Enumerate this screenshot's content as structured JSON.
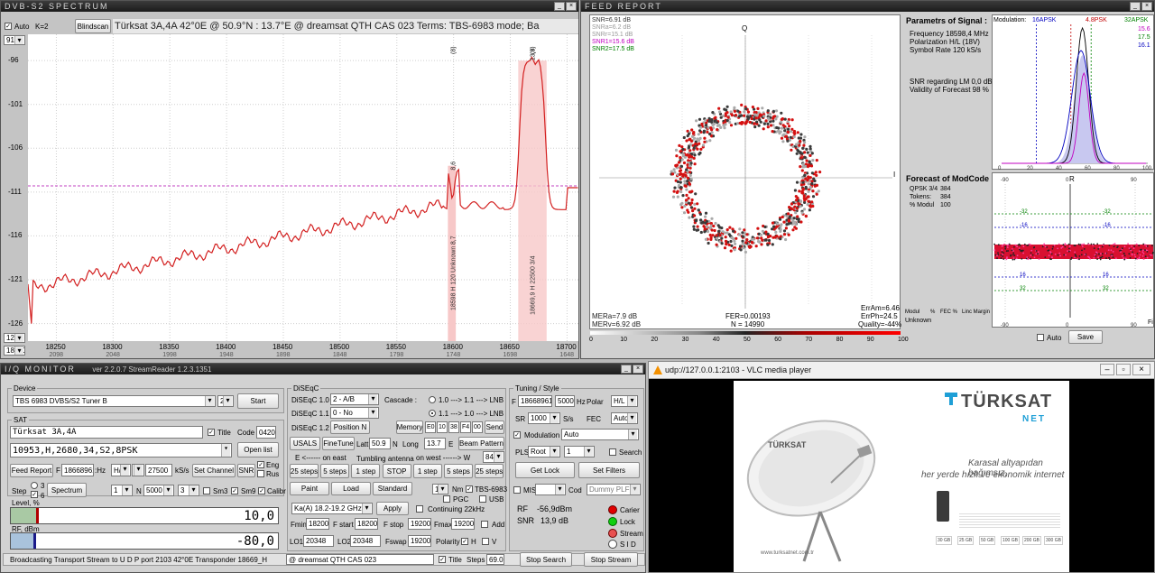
{
  "spectrum": {
    "title": "DVB-S2  SPECTRUM",
    "auto_label": "Auto",
    "k_label": "K=2",
    "blindscan_label": "Blindscan",
    "header_text": "Türksat 3A,4A    42°0E  @  50.9°N : 13.7°E     @ dreamsat QTH CAS 023      Terms:  TBS-6983 mode; Ba",
    "top_value": "91",
    "bottom_value": "12",
    "freq_box": "18200",
    "y_ticks": [
      "-96",
      "-101",
      "-106",
      "-111",
      "-116",
      "-121",
      "-126"
    ],
    "x_ticks": [
      "18250",
      "18300",
      "18350",
      "18400",
      "18450",
      "18500",
      "18550",
      "18600",
      "18650",
      "18700"
    ],
    "x_sub_ticks": [
      "2098",
      "2048",
      "1998",
      "1948",
      "1898",
      "1848",
      "1798",
      "1748",
      "1698",
      "1648"
    ],
    "marker1_top": "(8)",
    "marker2_top": "(9)",
    "peak1_value": "8,6",
    "peak1_snr": "8,7",
    "peak1_label": "18598 H  120  Unknown",
    "peak2_value": "13,8",
    "peak2_label": "18669,9 H  22500 3/4",
    "line_color": "#d32020"
  },
  "feed": {
    "title": "FEED  REPORT",
    "snr_lines": [
      "SNR=6.91 dB",
      "SNRa=6.2 dB",
      "SNRr=15.1 dB",
      "SNR1=15.6 dB",
      "SNR2=17.5 dB"
    ],
    "q_label": "Q",
    "i_label": "I",
    "mera": "MERa=7.9 dB",
    "merv": "MERv=6.92 dB",
    "fer": "FER=0.00193",
    "n_val": "N = 14990",
    "erram": "ErrAm=6.46",
    "errph": "ErrPh=24.5",
    "quality": "Quality=-44%",
    "scale": [
      "0",
      "10",
      "20",
      "30",
      "40",
      "50",
      "60",
      "70",
      "80",
      "90",
      "100"
    ],
    "params_title": "Parametrs of Signal :",
    "frequency": "Frequency   18598,4 MHz",
    "polarization": "Polarization   H/L (18V)",
    "symbol_rate": "Symbol Rate   120 kS/s",
    "snr_lm": "SNR regarding LM  0,0 dB",
    "validity": "Validity of Forecast  98 %",
    "forecast_title": "Forecast of ModCode",
    "fc_rows": [
      [
        "QPSK 3/4",
        "384"
      ],
      [
        "Tokens:",
        "384"
      ],
      [
        "% Modul",
        "100"
      ]
    ],
    "mod_header": [
      "Modul",
      "%",
      "FEC %",
      "Linc Margin"
    ],
    "mod_unknown": "Unknown",
    "modulation_label": "Modulation:",
    "mod_16apsk": "16APSK",
    "mod_48psk": "4.8PSK",
    "mod_32apsk": "32APSK",
    "right_vals": [
      "15.6",
      "17.5",
      "16.1"
    ],
    "hist_x": [
      "0",
      "20",
      "40",
      "60",
      "80",
      "100"
    ],
    "r_label": "R",
    "pol_x": [
      "-90",
      "0",
      "90"
    ],
    "pol_side": [
      "-32",
      "-16",
      "16",
      "32"
    ],
    "fi_label": "Fi",
    "auto_label": "Auto",
    "save_label": "Save"
  },
  "iq": {
    "title": "I/Q  MONITOR",
    "version": "ver 2.2.0.7  StreamReader 1.2.3.1351",
    "device_label": "Device",
    "device_value": "TBS 6983 DVBS/S2 Tuner B",
    "device_num": "2",
    "start_label": "Start",
    "sat_label": "SAT",
    "sat_value": "Türksat 3A,4A",
    "title_chk": "Title",
    "code_label": "Code",
    "code_value": "0420",
    "tp_value": "10953,H,2680,34,S2,8PSK",
    "open_list": "Open list",
    "feed_report": "Feed Report",
    "f_label": "F",
    "f_value": "18668961",
    "hz_label": ":Hz",
    "pol_value": "H/L",
    "pol_num": "1",
    "sr_value": "27500",
    "ks_label": "kS/s",
    "set_channel": "Set Channel",
    "snr_btn": "SNR",
    "eng_label": "Eng",
    "rus_label": "Rus",
    "step_label": "Step",
    "step3": "3",
    "step6": "6",
    "spectrum_btn": "Spectrum",
    "n1": "1",
    "n_label": "N",
    "n_value": "5000",
    "n3": "3",
    "sm3": "Sm3",
    "sm9": "Sm9",
    "calibr": "Calibr",
    "level_label": "Level, %",
    "level_value": "10,0",
    "rf_label": "RF, dBm",
    "rf_value": "-80,0",
    "status_text": "Broadcasting Transport Stream to  U D P port 2103    42°0E  Transponder  18669_H",
    "level_fill": 0.1,
    "rf_fill": 0.09
  },
  "diseqc": {
    "label": "DiSEqC",
    "d10": "DiSEqC 1.0",
    "d10v": "2 - A/B",
    "d11": "DiSEqC 1.1",
    "d11v": "0 - No",
    "d12": "DiSEqC 1.2",
    "position": "Position",
    "pos_n": "N",
    "cascade": "Cascade :",
    "casc1": "1.0 ---> 1.1 ---> LNB",
    "casc2": "1.1 ---> 1.0 ---> LNB",
    "memory": "Memory",
    "mem_vals": [
      "E0",
      "10",
      "38",
      "F4",
      "00"
    ],
    "send": "Send",
    "usals": "USALS",
    "finetune": "FineTune",
    "latt": "Latt",
    "latt_v": "50.9",
    "n_lbl": "N",
    "long": "Long",
    "long_v": "13.7",
    "e_lbl": "E",
    "beam": "Beam Pattern",
    "east": "E <------ on east",
    "tumbling": "Tumbling antenna",
    "west": "on  west  ------> W",
    "w_val": "84",
    "steps": [
      "25 steps",
      "5 steps",
      "1 step",
      "STOP",
      "1 step",
      "5 steps",
      "25 steps"
    ],
    "paint": "Paint",
    "load": "Load",
    "standard": "Standard",
    "nm_val": "1",
    "nm": "Nm",
    "tbs": "TBS-6983",
    "pgc": "PGC",
    "usb": "USB",
    "band": "Ka(A) 18.2-19.2 GHz",
    "apply": "Apply",
    "cont22": "Continuing 22kHz",
    "fmin": "Fmin",
    "fmin_v": "18200",
    "fstart": "F start",
    "fstart_v": "18200",
    "fstop": "F stop",
    "fstop_v": "19200",
    "fmax": "Fmax",
    "fmax_v": "19200",
    "add": "Add",
    "lo1": "LO1",
    "lo1_v": "20348",
    "lo2": "LO2",
    "lo2_v": "20348",
    "fswap": "Fswap",
    "fswap_v": "19200",
    "polarity": "Polarity",
    "h": "H",
    "v": "V",
    "qth": "@ dreamsat QTH CAS 023",
    "title_chk": "Title",
    "steps_lbl": "Steps",
    "steps_v": "69.0"
  },
  "tuning": {
    "label": "Tuning / Style",
    "f_label": "F",
    "f_value": "18668961",
    "sr_small": "5000",
    "hz": "Hz",
    "polar": "Polar",
    "polar_v": "H/L",
    "sr_label": "SR",
    "sr_value": "1000",
    "ss": "S/s",
    "fec": "FEC",
    "fec_v": "Auto",
    "modulation": "Modulation",
    "mod_v": "Auto",
    "pls": "PLS",
    "pls_v": "Root",
    "pls_n": "1",
    "search": "Search",
    "get_lock": "Get Lock",
    "set_filters": "Set Filters",
    "mis": "MIS",
    "cod": "Cod",
    "dummy": "Dummy PLF",
    "rf": "RF",
    "rf_v": "-56,9dBm",
    "snr": "SNR",
    "snr_v": "13,9 dB",
    "carier": "Carier",
    "lock": "Lock",
    "stream": "Stream",
    "sid": "S I D",
    "stop_search": "Stop Search",
    "stop_stream": "Stop Stream"
  },
  "vlc": {
    "title": "udp://127.0.0.1:2103 - VLC media player",
    "brand": "TÜRKSAT",
    "brand_sub": "NET",
    "slogan1": "Karasal altyapıdan bağımsız,",
    "slogan2": "her yerde hızlı ve ekonomik internet",
    "dish_brand": "TÜRKSAT",
    "site": "www.turksatnet.com.tr",
    "packs": [
      "30 GB",
      "25 GB",
      "50 GB",
      "100 GB",
      "200 GB",
      "300 GB"
    ]
  }
}
